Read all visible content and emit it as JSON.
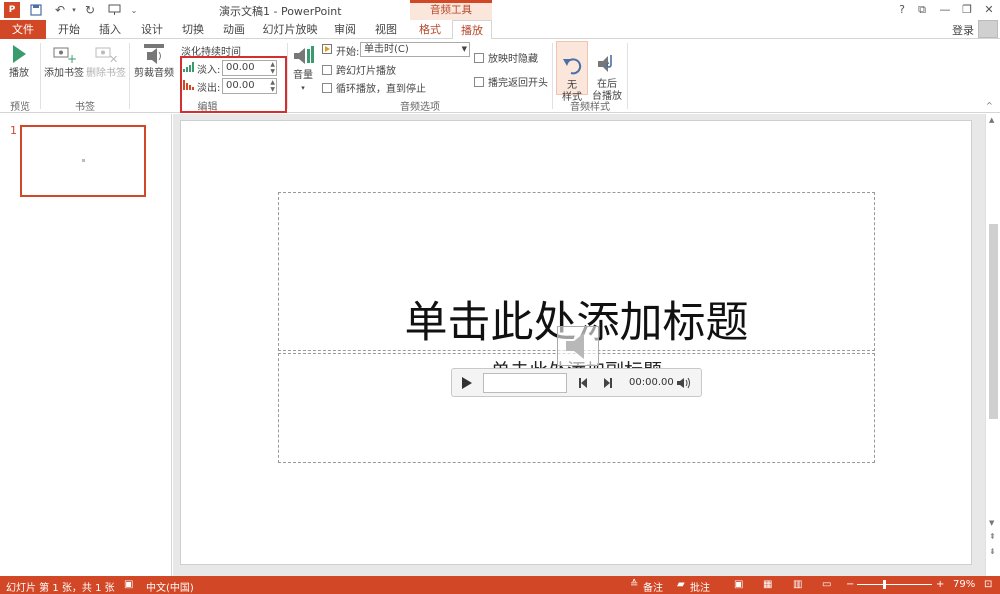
{
  "titlebar": {
    "doc_title": "演示文稿1 - PowerPoint",
    "context_tab": "音频工具",
    "help": "?",
    "restore_ribbon": "⧉",
    "minimize": "—",
    "maximize": "❐",
    "close": "✕"
  },
  "tabs": {
    "file": "文件",
    "home": "开始",
    "insert": "插入",
    "design": "设计",
    "transitions": "切换",
    "animations": "动画",
    "slideshow": "幻灯片放映",
    "review": "审阅",
    "view": "视图",
    "format": "格式",
    "playback": "播放",
    "login": "登录"
  },
  "ribbon": {
    "preview": {
      "play_label": "播放",
      "group": "预览"
    },
    "bookmarks": {
      "add_label": "添加书签",
      "remove_label": "删除书签",
      "group": "书签"
    },
    "editing": {
      "trim_label": "剪裁音频",
      "fade_title": "淡化持续时间",
      "fade_in_label": "淡入:",
      "fade_in_value": "00.00",
      "fade_out_label": "淡出:",
      "fade_out_value": "00.00",
      "group": "编辑"
    },
    "audio_options": {
      "volume_label": "音量",
      "start_label": "开始:",
      "start_value": "单击时(C)",
      "hide_label": "放映时隐藏",
      "cross_slides_label": "跨幻灯片播放",
      "loop_label": "循环播放，直到停止",
      "rewind_label": "播完返回开头",
      "group": "音频选项"
    },
    "audio_styles": {
      "no_style_label": "无\n样式",
      "background_label": "在后\n台播放",
      "group": "音频样式"
    }
  },
  "thumbnails": {
    "slide_number": "1"
  },
  "slide": {
    "title_placeholder": "单击此处添加标题",
    "subtitle_placeholder": "单击此处添加副标题",
    "player_time": "00:00.00"
  },
  "status": {
    "slide_info": "幻灯片 第 1 张，共 1 张",
    "language": "中文(中国)",
    "notes": "备注",
    "comments": "批注",
    "zoom": "79%"
  },
  "colors": {
    "accent": "#d24726",
    "highlight": "#d32f2f",
    "ribbon_bg": "#ffffff"
  }
}
